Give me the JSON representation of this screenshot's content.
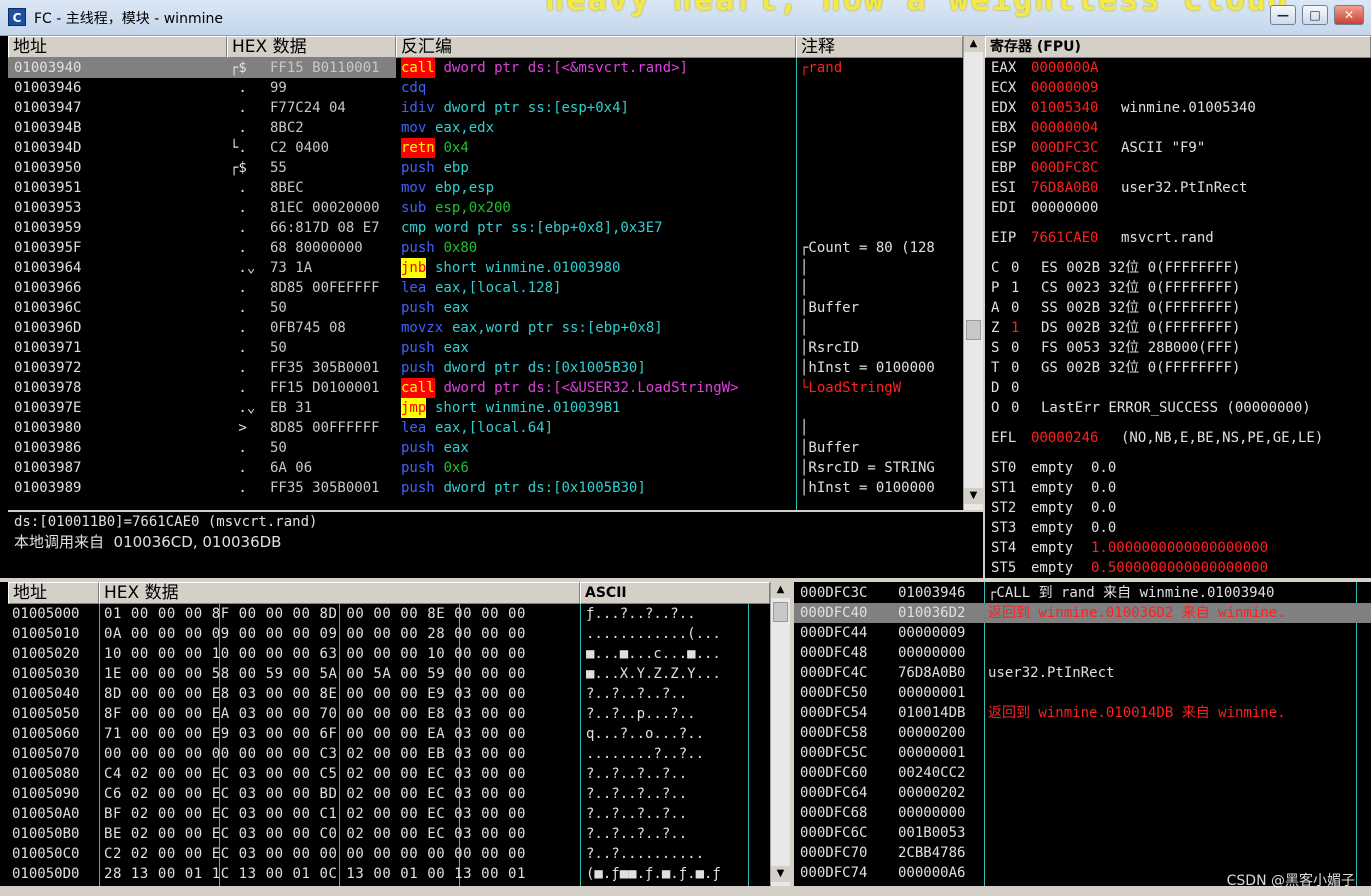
{
  "window": {
    "title": "FC - 主线程，模块 - winmine",
    "overlay_text": "heavy heart, now a weightless cloud",
    "icon_letter": "C",
    "buttons": {
      "minimize": "—",
      "maximize": "□",
      "close": "✕"
    }
  },
  "cpu": {
    "headers": {
      "address": "地址",
      "hex": "HEX 数据",
      "disasm": "反汇编",
      "comment": "注释"
    },
    "rows": [
      {
        "addr": "01003940",
        "mark": "┌$",
        "hex": "FF15 B0110001",
        "op": "call",
        "opnd": "dword ptr ds:[<&msvcrt.rand>]",
        "comment": "┌rand",
        "sel": true,
        "opclass": "hl-red",
        "opndclass": "mag",
        "cclass": "r"
      },
      {
        "addr": "01003946",
        "mark": " .",
        "hex": "99",
        "op": "cdq",
        "opnd": "",
        "comment": "",
        "opclass": "blue"
      },
      {
        "addr": "01003947",
        "mark": " .",
        "hex": "F77C24 04",
        "op": "idiv",
        "opnd": "dword ptr ss:[esp+0x4]",
        "comment": "",
        "opclass": "blue",
        "opndclass": "cyan"
      },
      {
        "addr": "0100394B",
        "mark": " .",
        "hex": "8BC2",
        "op": "mov",
        "opnd": "eax,edx",
        "comment": "",
        "opclass": "blue",
        "opndclass": "cyan"
      },
      {
        "addr": "0100394D",
        "mark": "└.",
        "hex": "C2 0400",
        "op": "retn",
        "opnd": "0x4",
        "comment": "",
        "opclass": "hl-red",
        "opndclass": "green"
      },
      {
        "addr": "01003950",
        "mark": "┌$",
        "hex": "55",
        "op": "push",
        "opnd": "ebp",
        "comment": "",
        "opclass": "blue",
        "opndclass": "cyan"
      },
      {
        "addr": "01003951",
        "mark": " .",
        "hex": "8BEC",
        "op": "mov",
        "opnd": "ebp,esp",
        "comment": "",
        "opclass": "blue",
        "opndclass": "cyan"
      },
      {
        "addr": "01003953",
        "mark": " .",
        "hex": "81EC 00020000",
        "op": "sub",
        "opnd": "esp,0x200",
        "comment": "",
        "opclass": "blue",
        "opndclass": "green"
      },
      {
        "addr": "01003959",
        "mark": " .",
        "hex": "66:817D 08 E7",
        "op": "cmp",
        "opnd": "word ptr ss:[ebp+0x8],0x3E7",
        "comment": "",
        "opclass": "cyan",
        "opndclass": "cyan"
      },
      {
        "addr": "0100395F",
        "mark": " .",
        "hex": "68 80000000",
        "op": "push",
        "opnd": "0x80",
        "comment": "┌Count = 80 (128",
        "opclass": "blue",
        "opndclass": "green",
        "cclass": "w"
      },
      {
        "addr": "01003964",
        "mark": " .⌄",
        "hex": "73 1A",
        "op": "jnb",
        "opnd": "short winmine.01003980",
        "comment": "│",
        "opclass": "hl-yel",
        "opndclass": "cyan",
        "cclass": "w"
      },
      {
        "addr": "01003966",
        "mark": " .",
        "hex": "8D85 00FEFFFF",
        "op": "lea",
        "opnd": "eax,[local.128]",
        "comment": "│",
        "opclass": "blue",
        "opndclass": "cyan",
        "cclass": "w"
      },
      {
        "addr": "0100396C",
        "mark": " .",
        "hex": "50",
        "op": "push",
        "opnd": "eax",
        "comment": "│Buffer",
        "opclass": "blue",
        "opndclass": "cyan",
        "cclass": "w"
      },
      {
        "addr": "0100396D",
        "mark": " .",
        "hex": "0FB745 08",
        "op": "movzx",
        "opnd": "eax,word ptr ss:[ebp+0x8]",
        "comment": "│",
        "opclass": "blue",
        "opndclass": "cyan",
        "cclass": "w"
      },
      {
        "addr": "01003971",
        "mark": " .",
        "hex": "50",
        "op": "push",
        "opnd": "eax",
        "comment": "│RsrcID",
        "opclass": "blue",
        "opndclass": "cyan",
        "cclass": "w"
      },
      {
        "addr": "01003972",
        "mark": " .",
        "hex": "FF35 305B0001",
        "op": "push",
        "opnd": "dword ptr ds:[0x1005B30]",
        "comment": "│hInst = 0100000",
        "opclass": "blue",
        "opndclass": "cyan",
        "cclass": "w"
      },
      {
        "addr": "01003978",
        "mark": " .",
        "hex": "FF15 D0100001",
        "op": "call",
        "opnd": "dword ptr ds:[<&USER32.LoadStringW>",
        "comment": "└LoadStringW",
        "opclass": "hl-red",
        "opndclass": "mag",
        "cclass": "r"
      },
      {
        "addr": "0100397E",
        "mark": " .⌄",
        "hex": "EB 31",
        "op": "jmp",
        "opnd": "short winmine.010039B1",
        "comment": "",
        "opclass": "hl-yel",
        "opndclass": "cyan"
      },
      {
        "addr": "01003980",
        "mark": " >",
        "hex": "8D85 00FFFFFF",
        "op": "lea",
        "opnd": "eax,[local.64]",
        "comment": "│",
        "opclass": "blue",
        "opndclass": "cyan",
        "cclass": "w"
      },
      {
        "addr": "01003986",
        "mark": " .",
        "hex": "50",
        "op": "push",
        "opnd": "eax",
        "comment": "│Buffer",
        "opclass": "blue",
        "opndclass": "cyan",
        "cclass": "w"
      },
      {
        "addr": "01003987",
        "mark": " .",
        "hex": "6A 06",
        "op": "push",
        "opnd": "0x6",
        "comment": "│RsrcID = STRING",
        "opclass": "blue",
        "opndclass": "green",
        "cclass": "w"
      },
      {
        "addr": "01003989",
        "mark": " .",
        "hex": "FF35 305B0001",
        "op": "push",
        "opnd": "dword ptr ds:[0x1005B30]",
        "comment": "│hInst = 0100000",
        "opclass": "blue",
        "opndclass": "cyan",
        "cclass": "w"
      }
    ]
  },
  "info": {
    "line1": "ds:[010011B0]=7661CAE0 (msvcrt.rand)",
    "line2": "本地调用来自  010036CD, 010036DB"
  },
  "registers": {
    "header": "寄存器 (FPU)",
    "gp": [
      {
        "name": "EAX",
        "value": "0000000A",
        "desc": "",
        "changed": true
      },
      {
        "name": "ECX",
        "value": "00000009",
        "desc": "",
        "changed": true
      },
      {
        "name": "EDX",
        "value": "01005340",
        "desc": "winmine.01005340",
        "changed": true
      },
      {
        "name": "EBX",
        "value": "00000004",
        "desc": "",
        "changed": true
      },
      {
        "name": "ESP",
        "value": "000DFC3C",
        "desc": "ASCII \"F9\"",
        "changed": true
      },
      {
        "name": "EBP",
        "value": "000DFC8C",
        "desc": "",
        "changed": true
      },
      {
        "name": "ESI",
        "value": "76D8A0B0",
        "desc": "user32.PtInRect",
        "changed": true
      },
      {
        "name": "EDI",
        "value": "00000000",
        "desc": "",
        "changed": false
      }
    ],
    "eip": {
      "name": "EIP",
      "value": "7661CAE0",
      "desc": "msvcrt.rand"
    },
    "flags": [
      {
        "f": "C",
        "v": "0",
        "seg": "ES 002B 32位 0(FFFFFFFF)",
        "changed": false
      },
      {
        "f": "P",
        "v": "1",
        "seg": "CS 0023 32位 0(FFFFFFFF)",
        "changed": false
      },
      {
        "f": "A",
        "v": "0",
        "seg": "SS 002B 32位 0(FFFFFFFF)",
        "changed": false
      },
      {
        "f": "Z",
        "v": "1",
        "seg": "DS 002B 32位 0(FFFFFFFF)",
        "changed": true
      },
      {
        "f": "S",
        "v": "0",
        "seg": "FS 0053 32位 28B000(FFF)",
        "changed": false
      },
      {
        "f": "T",
        "v": "0",
        "seg": "GS 002B 32位 0(FFFFFFFF)",
        "changed": false
      },
      {
        "f": "D",
        "v": "0",
        "seg": "",
        "changed": false
      },
      {
        "f": "O",
        "v": "0",
        "seg": "LastErr ERROR_SUCCESS (00000000)",
        "changed": false
      }
    ],
    "efl": {
      "name": "EFL",
      "value": "00000246",
      "desc": "(NO,NB,E,BE,NS,PE,GE,LE)"
    },
    "fpu": [
      {
        "name": "ST0",
        "state": "empty",
        "value": "0.0",
        "changed": false
      },
      {
        "name": "ST1",
        "state": "empty",
        "value": "0.0",
        "changed": false
      },
      {
        "name": "ST2",
        "state": "empty",
        "value": "0.0",
        "changed": false
      },
      {
        "name": "ST3",
        "state": "empty",
        "value": "0.0",
        "changed": false
      },
      {
        "name": "ST4",
        "state": "empty",
        "value": "1.0000000000000000000",
        "changed": true
      },
      {
        "name": "ST5",
        "state": "empty",
        "value": "0.5000000000000000000",
        "changed": true
      }
    ]
  },
  "dump": {
    "headers": {
      "address": "地址",
      "hex": "HEX 数据",
      "ascii": "ASCII"
    },
    "rows": [
      {
        "addr": "01005000",
        "hex": "01 00 00 00 8F 00 00 00 8D 00 00 00 8E 00 00 00",
        "ascii": "ƒ...?..?..?.."
      },
      {
        "addr": "01005010",
        "hex": "0A 00 00 00 09 00 00 00 09 00 00 00 28 00 00 00",
        "ascii": "............(..."
      },
      {
        "addr": "01005020",
        "hex": "10 00 00 00 10 00 00 00 63 00 00 00 10 00 00 00",
        "ascii": "■...■...c...■..."
      },
      {
        "addr": "01005030",
        "hex": "1E 00 00 00 58 00 59 00 5A 00 5A 00 59 00 00 00",
        "ascii": "■...X.Y.Z.Z.Y..."
      },
      {
        "addr": "01005040",
        "hex": "8D 00 00 00 E8 03 00 00 8E 00 00 00 E9 03 00 00",
        "ascii": "?..?..?..?.."
      },
      {
        "addr": "01005050",
        "hex": "8F 00 00 00 EA 03 00 00 70 00 00 00 E8 03 00 00",
        "ascii": "?..?..p...?.."
      },
      {
        "addr": "01005060",
        "hex": "71 00 00 00 E9 03 00 00 6F 00 00 00 EA 03 00 00",
        "ascii": "q...?..o...?.."
      },
      {
        "addr": "01005070",
        "hex": "00 00 00 00 00 00 00 00 C3 02 00 00 EB 03 00 00",
        "ascii": "........?..?.."
      },
      {
        "addr": "01005080",
        "hex": "C4 02 00 00 EC 03 00 00 C5 02 00 00 EC 03 00 00",
        "ascii": "?..?..?..?.."
      },
      {
        "addr": "01005090",
        "hex": "C6 02 00 00 EC 03 00 00 BD 02 00 00 EC 03 00 00",
        "ascii": "?..?..?..?.."
      },
      {
        "addr": "010050A0",
        "hex": "BF 02 00 00 EC 03 00 00 C1 02 00 00 EC 03 00 00",
        "ascii": "?..?..?..?.."
      },
      {
        "addr": "010050B0",
        "hex": "BE 02 00 00 EC 03 00 00 C0 02 00 00 EC 03 00 00",
        "ascii": "?..?..?..?.."
      },
      {
        "addr": "010050C0",
        "hex": "C2 02 00 00 EC 03 00 00 00 00 00 00 00 00 00 00",
        "ascii": "?..?.........."
      },
      {
        "addr": "010050D0",
        "hex": "28 13 00 01 1C 13 00 01 0C 13 00 01 00 13 00 01",
        "ascii": "(■.ƒ■■.ƒ.■.ƒ.■.ƒ"
      }
    ]
  },
  "stack": {
    "rows": [
      {
        "addr": "000DFC3C",
        "val": "01003946",
        "comment": "┌CALL 到 rand 来自 winmine.01003940",
        "style": "call"
      },
      {
        "addr": "000DFC40",
        "val": "010036D2",
        "comment": "返回到 winmine.010036D2 来自 winmine.",
        "style": "ret",
        "sel": true
      },
      {
        "addr": "000DFC44",
        "val": "00000009",
        "comment": ""
      },
      {
        "addr": "000DFC48",
        "val": "00000000",
        "comment": ""
      },
      {
        "addr": "000DFC4C",
        "val": "76D8A0B0",
        "comment": "user32.PtInRect",
        "style": "plain"
      },
      {
        "addr": "000DFC50",
        "val": "00000001",
        "comment": ""
      },
      {
        "addr": "000DFC54",
        "val": "010014DB",
        "comment": "返回到 winmine.010014DB 来自 winmine.",
        "style": "ret"
      },
      {
        "addr": "000DFC58",
        "val": "00000200",
        "comment": ""
      },
      {
        "addr": "000DFC5C",
        "val": "00000001",
        "comment": ""
      },
      {
        "addr": "000DFC60",
        "val": "00240CC2",
        "comment": ""
      },
      {
        "addr": "000DFC64",
        "val": "00000202",
        "comment": ""
      },
      {
        "addr": "000DFC68",
        "val": "00000000",
        "comment": ""
      },
      {
        "addr": "000DFC6C",
        "val": "001B0053",
        "comment": ""
      },
      {
        "addr": "000DFC70",
        "val": "2CBB4786",
        "comment": ""
      },
      {
        "addr": "000DFC74",
        "val": "000000A6",
        "comment": ""
      }
    ]
  },
  "watermark": "CSDN @黑客小媚子",
  "colors": {
    "changed": "#ff2020",
    "accent": "#30c0c0",
    "selection": "#808080"
  }
}
